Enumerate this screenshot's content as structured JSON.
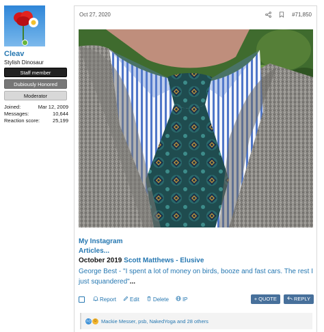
{
  "user": {
    "username": "Cleav",
    "title": "Stylish Dinosaur",
    "banners": [
      "Staff member",
      "Dubiously Honored",
      "Moderator"
    ],
    "stats": [
      {
        "label": "Joined:",
        "value": "Mar 12, 2009"
      },
      {
        "label": "Messages:",
        "value": "10,644"
      },
      {
        "label": "Reaction score:",
        "value": "25,199"
      }
    ]
  },
  "post": {
    "date": "Oct 27, 2020",
    "number": "#71,850",
    "icons": {
      "share": "share-icon",
      "bookmark": "bookmark-icon"
    },
    "link1": "My Instagram",
    "link2": "Articles...",
    "title_prefix": "October 2019",
    "title_artist": "Scott Matthews - Elusive",
    "quote": "George Best - \"I spent a lot of money on birds, booze and fast cars. The rest I just squandered\"",
    "quote_tail": "..."
  },
  "actions": {
    "report": "Report",
    "edit": "Edit",
    "delete": "Delete",
    "ip": "IP",
    "quote_btn": "+ QUOTE",
    "reply_btn": "REPLY"
  },
  "reactions": {
    "text": "Mackie Messer, psb, NakedYoga and 28 others"
  },
  "colors": {
    "link": "#2577b1",
    "button": "#47709b",
    "online": "#67b53c"
  }
}
